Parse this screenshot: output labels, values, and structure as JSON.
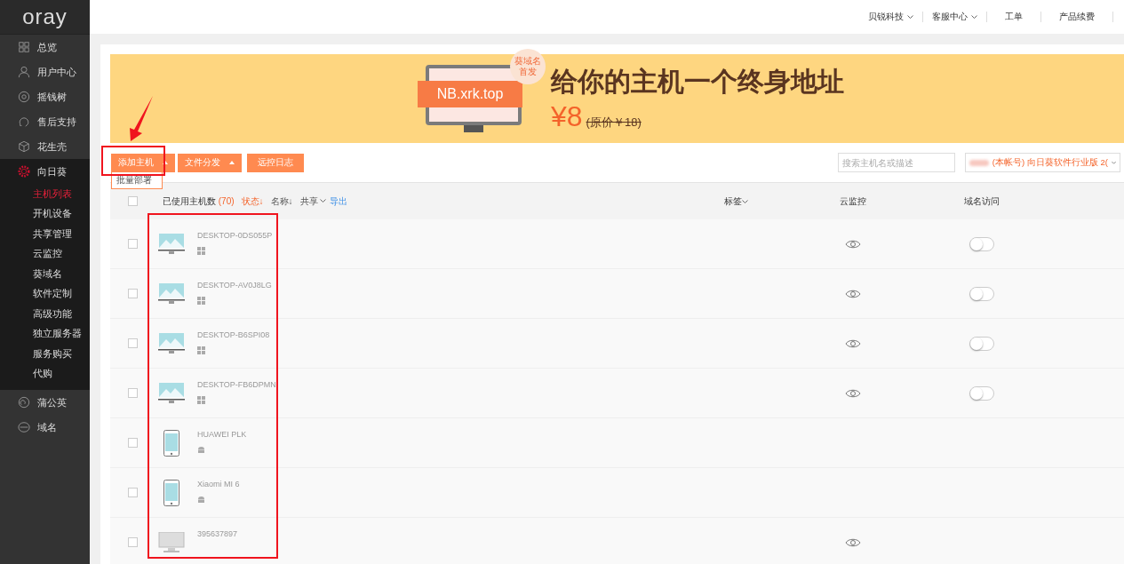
{
  "logo": "oray",
  "sidebar": {
    "items": [
      {
        "label": "总览",
        "kind": "grid",
        "selected": false
      },
      {
        "label": "用户中心",
        "kind": "user",
        "selected": false
      },
      {
        "label": "摇钱树",
        "kind": "target",
        "selected": false
      },
      {
        "label": "售后支持",
        "kind": "headset",
        "selected": false
      },
      {
        "label": "花生壳",
        "kind": "cube",
        "selected": false
      },
      {
        "label": "向日葵",
        "kind": "sunflower",
        "selected": true,
        "children": [
          {
            "label": "主机列表",
            "selected": true
          },
          {
            "label": "开机设备",
            "selected": false
          },
          {
            "label": "共享管理",
            "selected": false
          },
          {
            "label": "云监控",
            "selected": false
          },
          {
            "label": "葵域名",
            "selected": false
          },
          {
            "label": "软件定制",
            "selected": false
          },
          {
            "label": "高级功能",
            "selected": false
          },
          {
            "label": "独立服务器",
            "selected": false
          },
          {
            "label": "服务购买",
            "selected": false
          },
          {
            "label": "代购",
            "selected": false
          }
        ]
      },
      {
        "label": "蒲公英",
        "kind": "swirl",
        "selected": false
      },
      {
        "label": "域名",
        "kind": "www",
        "selected": false
      }
    ]
  },
  "topbar": [
    {
      "label": "贝锐科技",
      "dropdown": true
    },
    {
      "label": "客服中心",
      "dropdown": true
    },
    {
      "label": "工单",
      "dropdown": false
    },
    {
      "label": "产品续费",
      "dropdown": false
    }
  ],
  "banner": {
    "domain": "NB.xrk.top",
    "badge": "葵域名首发",
    "headline": "给你的主机一个终身地址",
    "price": "¥8",
    "original_price": "(原价￥18)"
  },
  "toolbar": {
    "buttons": [
      {
        "label": "添加主机",
        "dropdown": true
      },
      {
        "label": "文件分发",
        "dropdown": true
      },
      {
        "label": "远控日志",
        "dropdown": false
      }
    ],
    "menu": [
      "批量部署"
    ],
    "search": {
      "placeholder": "搜索主机名或描述"
    },
    "account": "(本帐号) 向日葵软件行业版 2("
  },
  "table": {
    "header": {
      "checked": false,
      "count_label": "已使用主机数",
      "count": "(70)",
      "sorts": [
        {
          "label": "状态",
          "arrow": "↓",
          "active": true
        },
        {
          "label": "名称",
          "arrow": "↓",
          "active": false
        },
        {
          "label": "共享",
          "active": false
        }
      ],
      "export": "导出",
      "tags": "标签",
      "monitor": "云监控",
      "domain": "域名访问"
    },
    "rows": [
      {
        "name": "DESKTOP-0DS055P",
        "kind": "windows-desktop",
        "checked": false,
        "monitor": true,
        "domain_access": {
          "on": false
        }
      },
      {
        "name": "DESKTOP-AV0J8LG",
        "kind": "windows-desktop",
        "checked": false,
        "monitor": true,
        "domain_access": {
          "on": false
        }
      },
      {
        "name": "DESKTOP-B6SPI08",
        "kind": "windows-desktop",
        "checked": false,
        "monitor": true,
        "domain_access": {
          "on": false
        }
      },
      {
        "name": "DESKTOP-FB6DPMN",
        "kind": "windows-desktop",
        "checked": false,
        "monitor": true,
        "domain_access": {
          "on": false
        }
      },
      {
        "name": "HUAWEI PLK",
        "kind": "android-phone",
        "checked": false,
        "monitor": false,
        "domain_access": null
      },
      {
        "name": "Xiaomi MI 6",
        "kind": "android-phone",
        "checked": false,
        "monitor": false,
        "domain_access": null
      },
      {
        "name": "395637897",
        "kind": "pc",
        "checked": false,
        "monitor": true,
        "domain_access": null
      }
    ]
  }
}
